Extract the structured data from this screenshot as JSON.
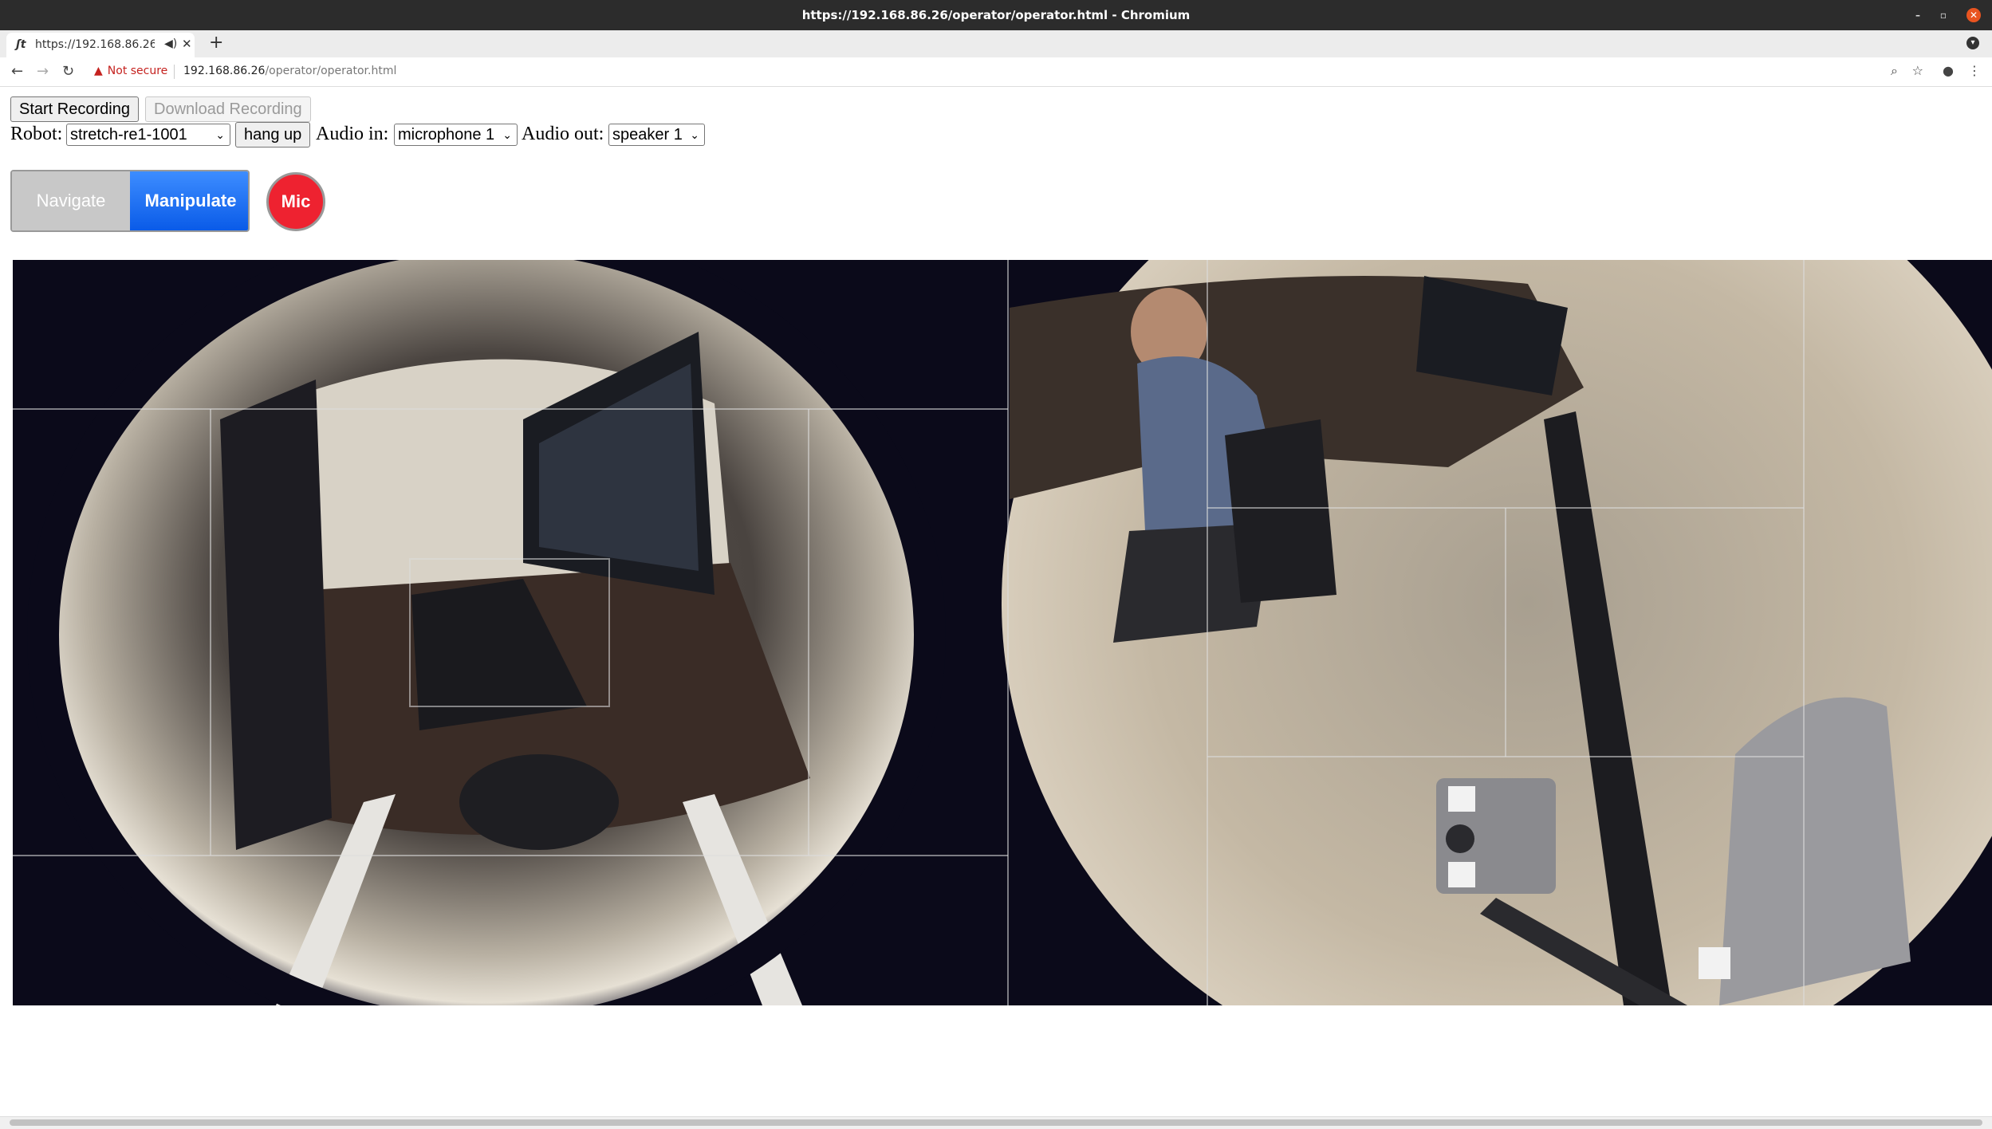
{
  "window": {
    "title": "https://192.168.86.26/operator/operator.html - Chromium"
  },
  "tab": {
    "favicon": "ʃt",
    "title": "https://192.168.86.26/operator/operator.html",
    "audio_icon": "speaker-icon",
    "close": "✕",
    "new_tab": "+"
  },
  "address": {
    "security_text": "Not secure",
    "host": "192.168.86.26",
    "path": "/operator/operator.html"
  },
  "recording": {
    "start_label": "Start Recording",
    "download_label": "Download Recording"
  },
  "controls": {
    "robot_label": "Robot:",
    "robot_value": "stretch-re1-1001",
    "hangup_label": "hang up",
    "audio_in_label": "Audio in:",
    "audio_in_value": "microphone 1",
    "audio_out_label": "Audio out:",
    "audio_out_value": "speaker 1"
  },
  "modes": {
    "navigate_label": "Navigate",
    "manipulate_label": "Manipulate",
    "mic_label": "Mic",
    "active": "Manipulate"
  },
  "colors": {
    "manipulate": "#1565f0",
    "mic": "#ee2230",
    "navigate": "#c8c8c8"
  }
}
